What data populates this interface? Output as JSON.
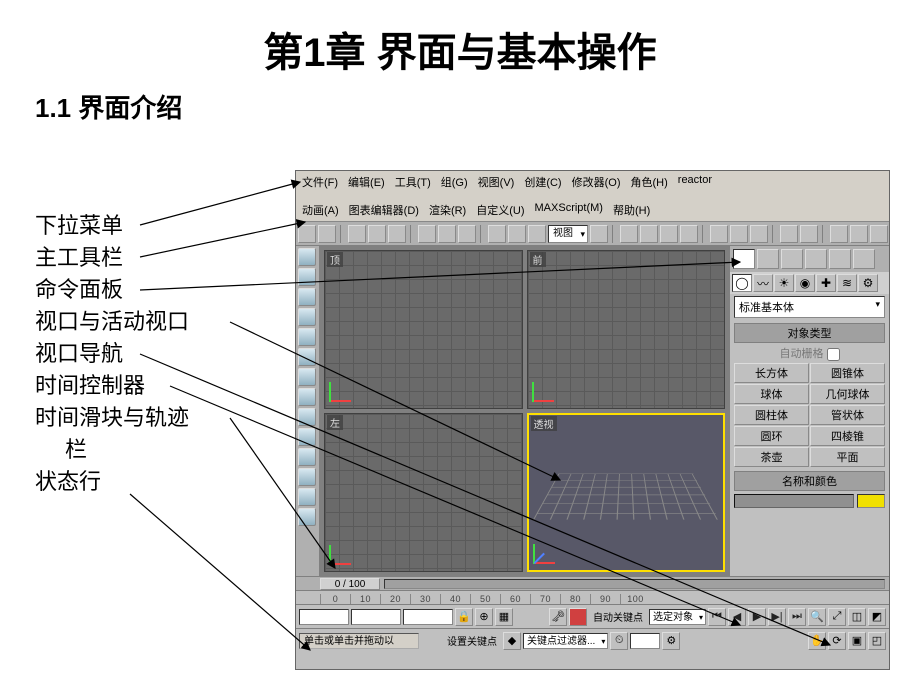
{
  "title": "第1章  界面与基本操作",
  "section": "1.1  界面介绍",
  "labels": [
    "下拉菜单",
    "主工具栏",
    "命令面板",
    "视口与活动视口",
    "视口导航",
    "时间控制器",
    "时间滑块与轨迹",
    "栏",
    "状态行"
  ],
  "menubar": {
    "row1": [
      "文件(F)",
      "编辑(E)",
      "工具(T)",
      "组(G)",
      "视图(V)",
      "创建(C)",
      "修改器(O)",
      "角色(H)",
      "reactor"
    ],
    "row2": [
      "动画(A)",
      "图表编辑器(D)",
      "渲染(R)",
      "自定义(U)",
      "MAXScript(M)",
      "帮助(H)"
    ]
  },
  "viewCombo": "视图",
  "viewports": {
    "top": "顶",
    "front": "前",
    "left": "左",
    "persp": "透视"
  },
  "cmdpanel": {
    "dropdown": "标准基本体",
    "rollouts": {
      "objtype": "对象类型",
      "autogrid": "自动栅格",
      "namecolor": "名称和颜色"
    },
    "objects": [
      [
        "长方体",
        "圆锥体"
      ],
      [
        "球体",
        "几何球体"
      ],
      [
        "圆柱体",
        "管状体"
      ],
      [
        "圆环",
        "四棱锥"
      ],
      [
        "茶壶",
        "平面"
      ]
    ]
  },
  "track": {
    "slider": "0 / 100"
  },
  "timeline_ticks": [
    "0",
    "10",
    "20",
    "30",
    "40",
    "50",
    "60",
    "70",
    "80",
    "90",
    "100"
  ],
  "bottom": {
    "prompt": "单击或单击并拖动以",
    "autokey": "自动关键点",
    "selset": "选定对象",
    "setkey": "设置关键点",
    "keyfilter": "关键点过滤器..."
  }
}
